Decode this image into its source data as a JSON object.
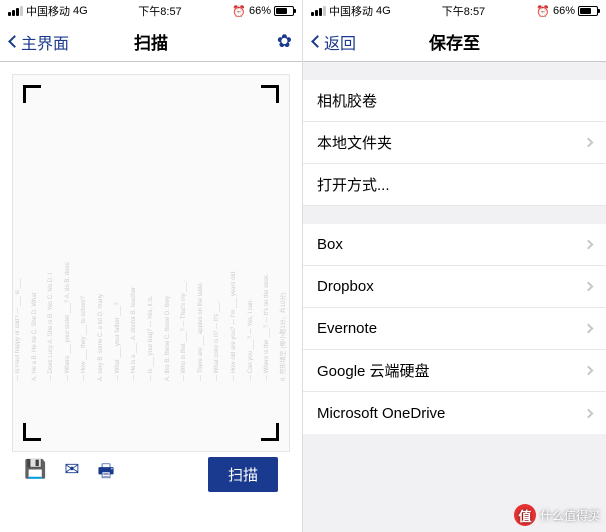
{
  "status": {
    "carrier": "中国移动",
    "network": "4G",
    "time": "下午8:57",
    "battery_pct": "66%"
  },
  "left": {
    "back_label": "主界面",
    "title": "扫描",
    "doc_hint_title": "《貌似英语》1A 试卷 (U1-U10)",
    "toolbar": {
      "scan_button": "扫描"
    }
  },
  "right": {
    "back_label": "返回",
    "title": "保存至",
    "group1": [
      {
        "label": "相机胶卷"
      },
      {
        "label": "本地文件夹"
      },
      {
        "label": "打开方式..."
      }
    ],
    "group2": [
      {
        "label": "Box"
      },
      {
        "label": "Dropbox"
      },
      {
        "label": "Evernote"
      },
      {
        "label": "Google 云端硬盘"
      },
      {
        "label": "Microsoft OneDrive"
      }
    ]
  },
  "watermark": {
    "badge": "值",
    "text": "什么值得买"
  }
}
